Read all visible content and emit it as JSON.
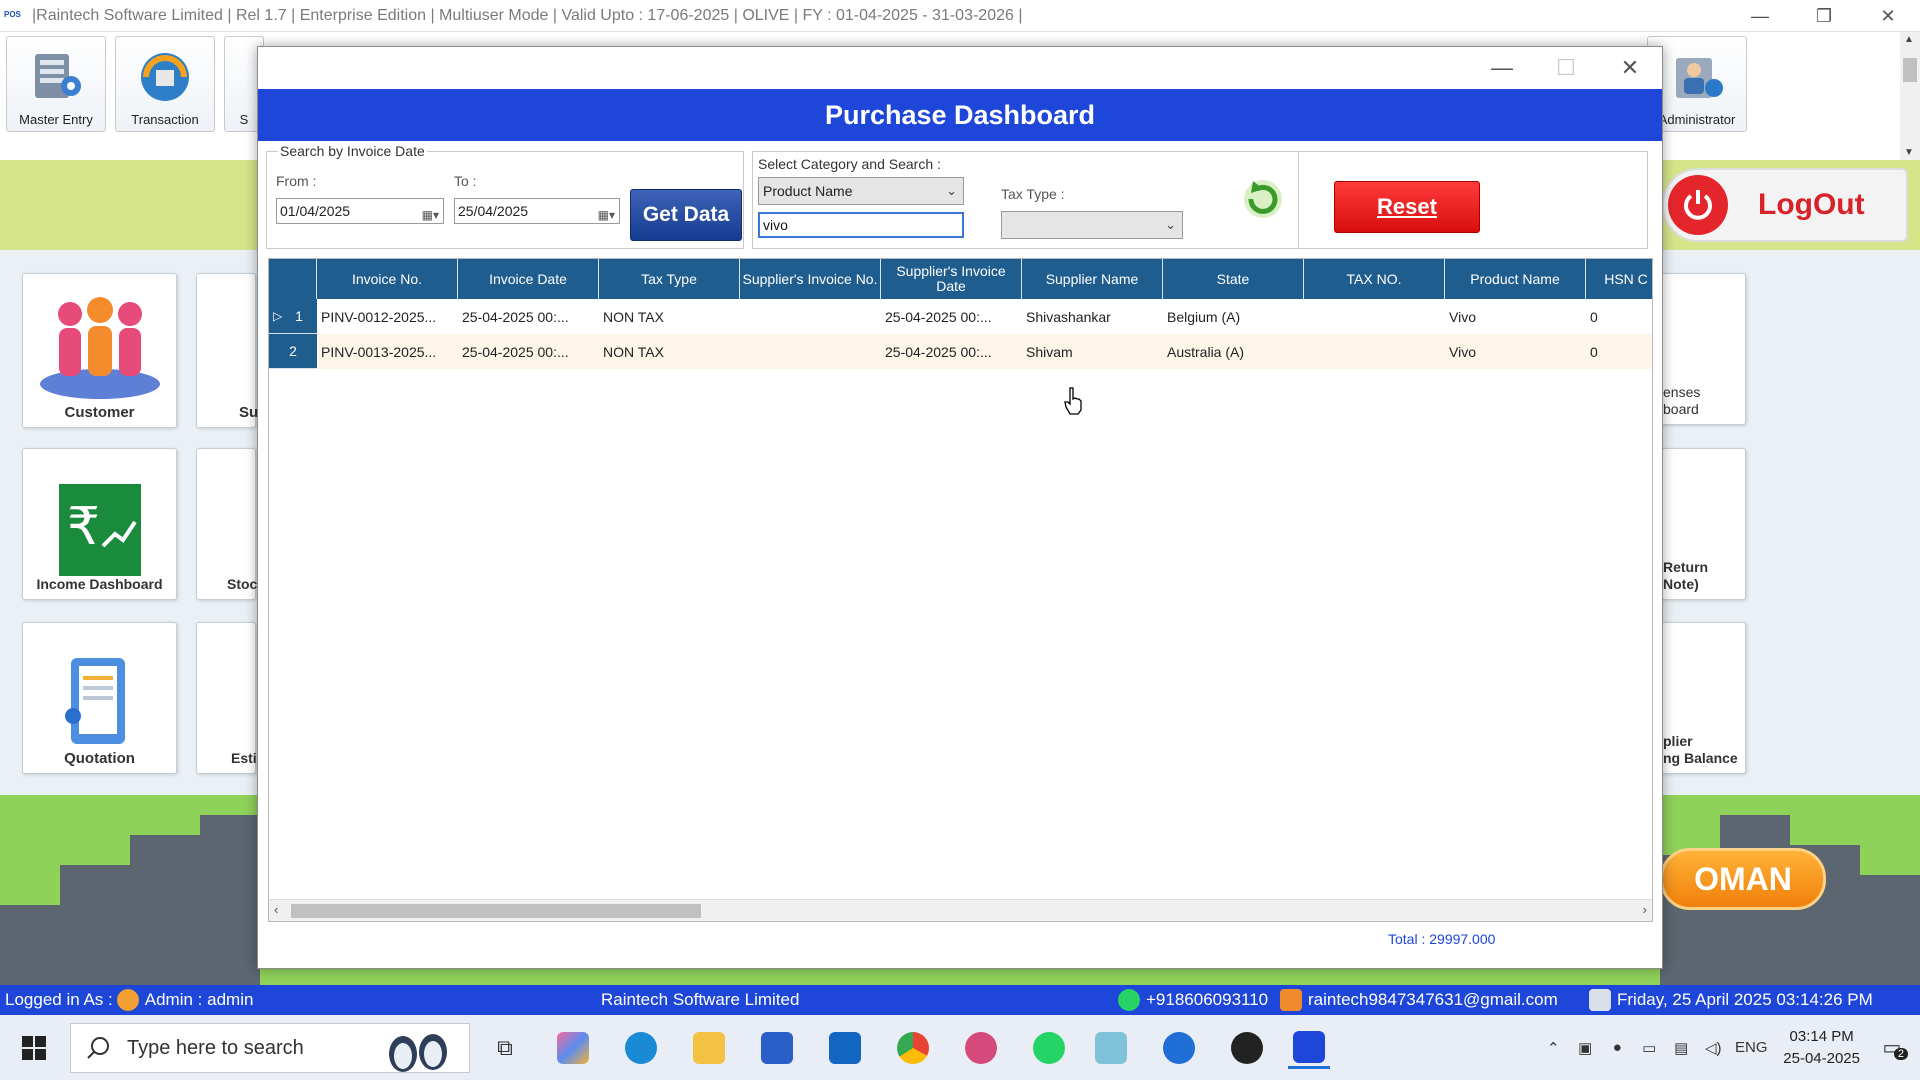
{
  "app": {
    "logo_text": "POS",
    "title": "|Raintech Software Limited | Rel 1.7  |  Enterprise Edition  |  Multiuser Mode  |  Valid Upto : 17-06-2025  |  OLIVE  |  FY : 01-04-2025  -  31-03-2026  |",
    "minimize": "—",
    "restore": "❐",
    "close": "✕"
  },
  "toolbar": {
    "buttons": [
      {
        "label": "Master Entry",
        "icon": "master-entry-icon"
      },
      {
        "label": "Transaction",
        "icon": "transaction-icon"
      },
      {
        "label": "S",
        "icon": "sales-icon"
      },
      {
        "label": "Administrator",
        "icon": "administrator-icon"
      }
    ]
  },
  "tiles": {
    "customer": "Customer",
    "income_dashboard": "Income Dashboard",
    "quotation": "Quotation",
    "su": "Su",
    "stoc": "Stoc",
    "esti": "Esti",
    "expenses": "enses\nboard",
    "return": "Return\nNote)",
    "supplier": "plier\nng Balance"
  },
  "logout": {
    "label": "LogOut"
  },
  "oman": {
    "label": "OMAN"
  },
  "dialog": {
    "title": "Purchase Dashboard",
    "minimize": "—",
    "maximize": "☐",
    "close": "✕",
    "search_group_title": "Search by Invoice Date",
    "from_label": "From :",
    "to_label": "To :",
    "from_date": "01/04/2025",
    "to_date": "25/04/2025",
    "get_data": "Get Data",
    "category_group_title": "Select Category and Search :",
    "category_value": "Product Name",
    "search_value": "vivo",
    "tax_type_label": "Tax Type :",
    "tax_type_value": "",
    "reset": "Reset",
    "total": "Total : 29997.000"
  },
  "grid": {
    "columns": [
      "Invoice No.",
      "Invoice Date",
      "Tax Type",
      "Supplier's Invoice No.",
      "Supplier's Invoice Date",
      "Supplier Name",
      "State",
      "TAX NO.",
      "Product Name",
      "HSN C"
    ],
    "rows": [
      {
        "num": "1",
        "cells": [
          "PINV-0012-2025...",
          "25-04-2025 00:...",
          "NON TAX",
          "",
          "25-04-2025 00:...",
          "Shivashankar",
          "Belgium (A)",
          "",
          "Vivo",
          "0"
        ]
      },
      {
        "num": "2",
        "cells": [
          "PINV-0013-2025...",
          "25-04-2025 00:...",
          "NON TAX",
          "",
          "25-04-2025 00:...",
          "Shivam",
          "Australia (A)",
          "",
          "Vivo",
          "0"
        ]
      }
    ]
  },
  "statusbar": {
    "logged_in": "Logged in As : ",
    "user": "Admin  :  admin",
    "company": "Raintech Software Limited",
    "phone": "+918606093110",
    "email": "raintech9847347631@gmail.com",
    "datetime": "Friday, 25 April 2025 03:14:26 PM"
  },
  "taskbar": {
    "search_placeholder": "Type here to search",
    "lang": "ENG",
    "time": "03:14 PM",
    "date": "25-04-2025",
    "notifications": "2"
  },
  "colors": {
    "accent": "#1e46d8",
    "grid_header": "#1f5d8f",
    "reset_red": "#e01414",
    "get_data_blue": "#1f4aa0"
  }
}
